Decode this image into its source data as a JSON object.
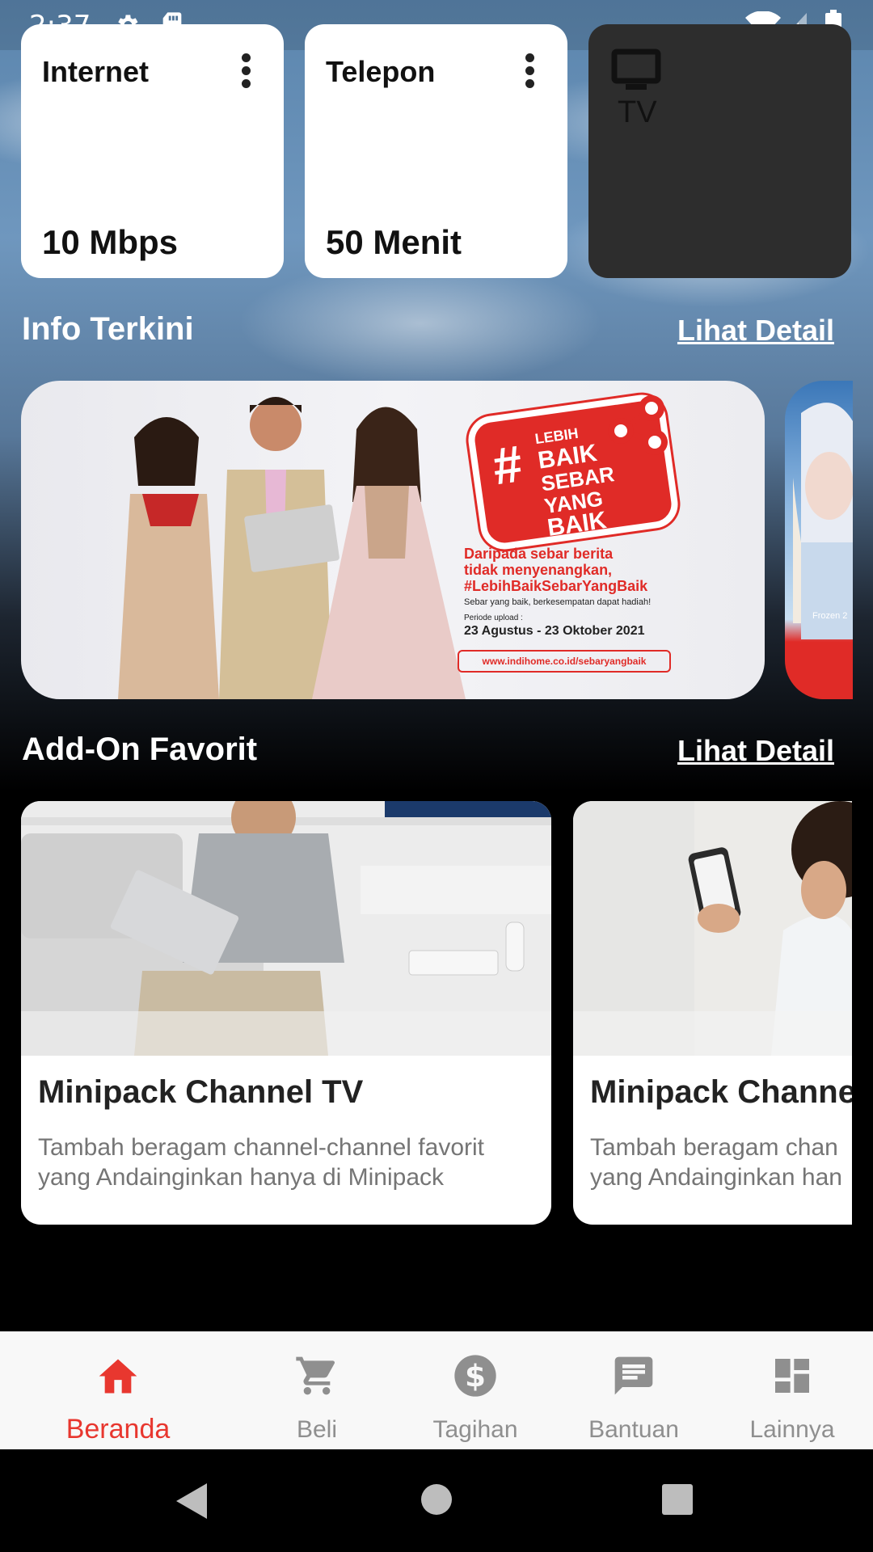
{
  "status_bar": {
    "time": "2:37"
  },
  "quota_cards": [
    {
      "label": "Internet",
      "value": "10 Mbps"
    },
    {
      "label": "Telepon",
      "value": "50 Menit"
    },
    {
      "label": "TV"
    }
  ],
  "info": {
    "title": "Info Terkini",
    "link": "Lihat Detail",
    "banner": {
      "hash": "#",
      "badge_lines": [
        "LEBIH",
        "BAIK",
        "SEBAR YANG",
        "BAIK"
      ],
      "headline_1": "Daripada sebar berita",
      "headline_2": "tidak menyenangkan,",
      "headline_3": "#LebihBaikSebarYangBaik",
      "subline": "Sebar yang baik, berkesempatan dapat hadiah!",
      "period_label": "Periode upload :",
      "period": "23 Agustus - 23 Oktober 2021",
      "url": "www.indihome.co.id/sebaryangbaik"
    },
    "banner2_caption": "Frozen 2"
  },
  "addon": {
    "title": "Add-On Favorit",
    "link": "Lihat Detail",
    "cards": [
      {
        "title": "Minipack Channel TV",
        "desc_1": "Tambah beragam channel-channel favorit",
        "desc_2": "yang Andainginkan hanya di Minipack"
      },
      {
        "title": "Minipack Channe",
        "desc_1": "Tambah beragam chan",
        "desc_2": "yang Andainginkan han"
      }
    ]
  },
  "bottom_nav": [
    {
      "label": "Beranda",
      "icon": "home-icon",
      "active": true
    },
    {
      "label": "Beli",
      "icon": "cart-icon"
    },
    {
      "label": "Tagihan",
      "icon": "dollar-icon"
    },
    {
      "label": "Bantuan",
      "icon": "chat-icon"
    },
    {
      "label": "Lainnya",
      "icon": "dashboard-icon"
    }
  ],
  "colors": {
    "accent": "#e8372f",
    "inactive": "#8f8f8f",
    "promo_red": "#e02b27"
  }
}
